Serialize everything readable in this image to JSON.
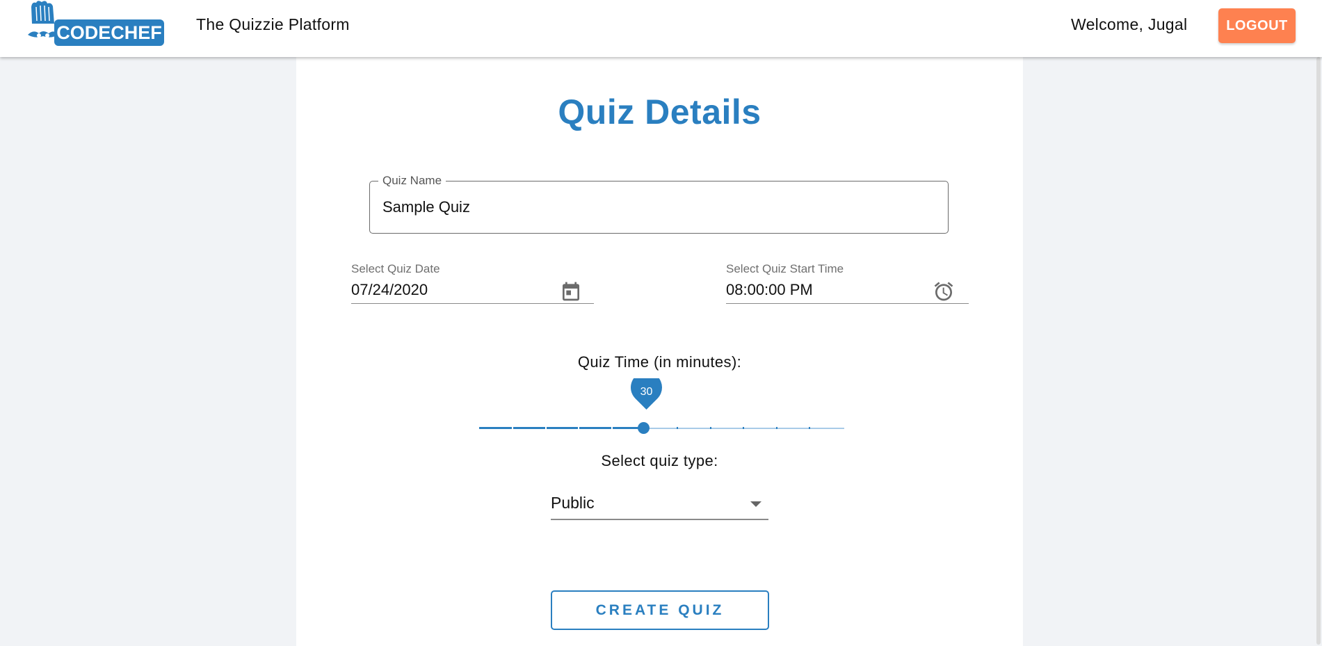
{
  "header": {
    "logo_text": "CODECHEF",
    "platform_title": "The Quizzie Platform",
    "welcome_text": "Welcome, Jugal",
    "logout_label": "LOGOUT"
  },
  "form": {
    "title": "Quiz Details",
    "quiz_name": {
      "label": "Quiz Name",
      "value": "Sample Quiz"
    },
    "quiz_date": {
      "label": "Select Quiz Date",
      "value": "07/24/2020",
      "icon": "calendar-icon"
    },
    "start_time": {
      "label": "Select Quiz Start Time",
      "value": "08:00:00 PM",
      "icon": "alarm-clock-icon"
    },
    "quiz_time": {
      "label": "Quiz Time (in minutes):",
      "value": "30",
      "fraction": 0.45
    },
    "quiz_type": {
      "label": "Select quiz type:",
      "value": "Public"
    },
    "create_label": "CREATE QUIZ"
  },
  "colors": {
    "primary": "#2a7fc0",
    "logout": "#fe8150",
    "background": "#f1f3f6"
  }
}
